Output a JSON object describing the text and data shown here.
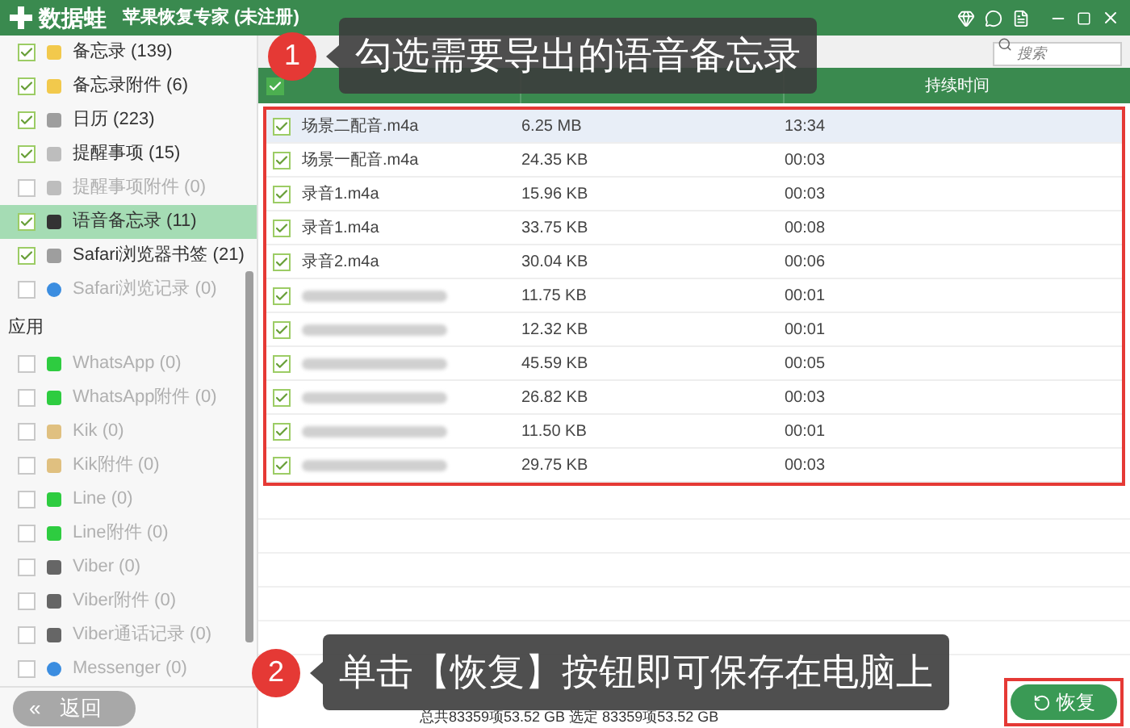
{
  "window": {
    "logo": "数据蛙",
    "title": "苹果恢复专家 (未注册)"
  },
  "search": {
    "placeholder": "搜索"
  },
  "sidebar": {
    "items": [
      {
        "label": "备忘录 (139)",
        "kind": "note",
        "checked": true,
        "disabled": false,
        "selected": false
      },
      {
        "label": "备忘录附件 (6)",
        "kind": "note",
        "checked": true,
        "disabled": false,
        "selected": false
      },
      {
        "label": "日历 (223)",
        "kind": "calendar",
        "checked": true,
        "disabled": false,
        "selected": false
      },
      {
        "label": "提醒事项 (15)",
        "kind": "reminder",
        "checked": true,
        "disabled": false,
        "selected": false
      },
      {
        "label": "提醒事项附件 (0)",
        "kind": "reminder",
        "checked": false,
        "disabled": true,
        "selected": false
      },
      {
        "label": "语音备忘录 (11)",
        "kind": "voice",
        "checked": true,
        "disabled": false,
        "selected": true
      },
      {
        "label": "Safari浏览器书签 (21)",
        "kind": "bookmark",
        "checked": true,
        "disabled": false,
        "selected": false
      },
      {
        "label": "Safari浏览记录 (0)",
        "kind": "globe",
        "checked": false,
        "disabled": true,
        "selected": false
      }
    ],
    "section": "应用",
    "apps": [
      {
        "label": "WhatsApp (0)",
        "kind": "chat",
        "checked": false,
        "disabled": true
      },
      {
        "label": "WhatsApp附件 (0)",
        "kind": "chat",
        "checked": false,
        "disabled": true
      },
      {
        "label": "Kik (0)",
        "kind": "kik",
        "checked": false,
        "disabled": true
      },
      {
        "label": "Kik附件 (0)",
        "kind": "kik",
        "checked": false,
        "disabled": true
      },
      {
        "label": "Line (0)",
        "kind": "chat",
        "checked": false,
        "disabled": true
      },
      {
        "label": "Line附件 (0)",
        "kind": "chat",
        "checked": false,
        "disabled": true
      },
      {
        "label": "Viber (0)",
        "kind": "phone",
        "checked": false,
        "disabled": true
      },
      {
        "label": "Viber附件 (0)",
        "kind": "phone",
        "checked": false,
        "disabled": true
      },
      {
        "label": "Viber通话记录 (0)",
        "kind": "phone",
        "checked": false,
        "disabled": true
      },
      {
        "label": "Messenger (0)",
        "kind": "globe",
        "checked": false,
        "disabled": true
      }
    ]
  },
  "table": {
    "all_checked": true,
    "duration_column": "持续时间",
    "rows": [
      {
        "kind": "named",
        "name": "场景二配音.m4a",
        "size": "6.25 MB",
        "duration": "13:34",
        "checked": true,
        "selected": true
      },
      {
        "kind": "named",
        "name": "场景一配音.m4a",
        "size": "24.35 KB",
        "duration": "00:03",
        "checked": true,
        "selected": false
      },
      {
        "kind": "named",
        "name": "录音1.m4a",
        "size": "15.96 KB",
        "duration": "00:03",
        "checked": true,
        "selected": false
      },
      {
        "kind": "named",
        "name": "录音1.m4a",
        "size": "33.75 KB",
        "duration": "00:08",
        "checked": true,
        "selected": false
      },
      {
        "kind": "named",
        "name": "录音2.m4a",
        "size": "30.04 KB",
        "duration": "00:06",
        "checked": true,
        "selected": false
      },
      {
        "kind": "blurred",
        "size": "11.75 KB",
        "duration": "00:01",
        "checked": true,
        "selected": false
      },
      {
        "kind": "blurred",
        "size": "12.32 KB",
        "duration": "00:01",
        "checked": true,
        "selected": false
      },
      {
        "kind": "blurred",
        "size": "45.59 KB",
        "duration": "00:05",
        "checked": true,
        "selected": false
      },
      {
        "kind": "blurred",
        "size": "26.82 KB",
        "duration": "00:03",
        "checked": true,
        "selected": false
      },
      {
        "kind": "blurred",
        "size": "11.50 KB",
        "duration": "00:01",
        "checked": true,
        "selected": false
      },
      {
        "kind": "blurred",
        "size": "29.75 KB",
        "duration": "00:03",
        "checked": true,
        "selected": false
      }
    ]
  },
  "status_bar": "总共83359项53.52 GB 选定 83359项53.52 GB",
  "back_button": {
    "icon": "«",
    "label": "返回"
  },
  "recover_button": "恢复",
  "callouts": [
    {
      "number": "1",
      "text": "勾选需要导出的语音备忘录"
    },
    {
      "number": "2",
      "text": "单击【恢复】按钮即可保存在电脑上"
    }
  ]
}
